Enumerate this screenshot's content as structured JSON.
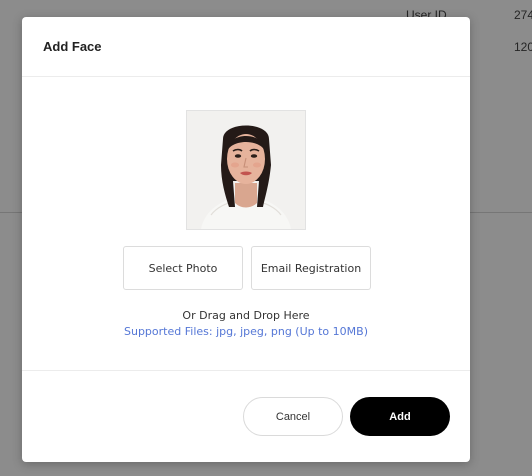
{
  "background": {
    "column_header": "User ID",
    "row_values": [
      "274",
      "120"
    ]
  },
  "modal": {
    "title": "Add Face",
    "photo": {
      "icon": "face-photo"
    },
    "buttons": {
      "select_photo": "Select Photo",
      "email_registration": "Email Registration",
      "cancel": "Cancel",
      "add": "Add"
    },
    "drag_text": "Or Drag and Drop Here",
    "supported_files": "Supported Files: jpg, jpeg, png (Up to 10MB)"
  },
  "colors": {
    "overlay": "rgba(0,0,0,0.45)",
    "link": "#5577d6",
    "primary_button": "#000000"
  }
}
